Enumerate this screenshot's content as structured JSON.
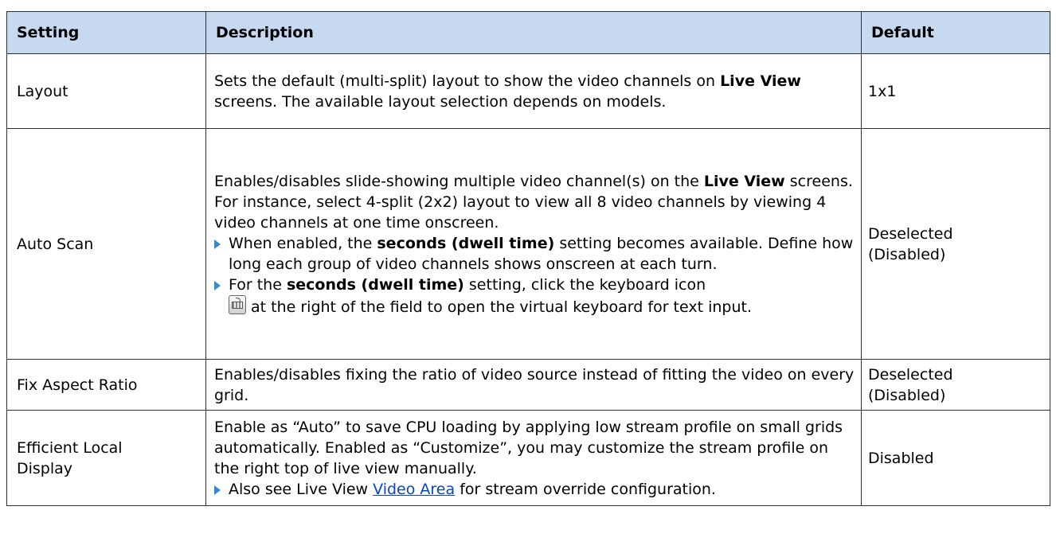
{
  "headers": {
    "setting": "Setting",
    "description": "Description",
    "default": "Default"
  },
  "rows": {
    "layout": {
      "setting": "Layout",
      "desc": {
        "t1": "Sets the default (multi-split) layout to show the video channels on",
        "b1": "Live View",
        "t2": "screens. The available layout selection depends on models."
      },
      "default": "1x1"
    },
    "auto_scan": {
      "setting": "Auto Scan",
      "desc": {
        "t1": "Enables/disables slide-showing multiple video channel(s) on the",
        "b1": "Live View",
        "t2": "screens. For instance, select 4-split (2x2) layout to view all 8 video channels by viewing 4 video channels at one time onscreen.",
        "bullet1_t1": "When enabled, the",
        "bullet1_b1": "seconds (dwell time)",
        "bullet1_t2": "setting becomes available. Define how long each group of video channels shows onscreen at each turn.",
        "bullet2_t1": "For the",
        "bullet2_b1": "seconds (dwell time)",
        "bullet2_t2": "setting, click the keyboard icon",
        "bullet2_t3": "at the right of the field to open the virtual keyboard for text input."
      },
      "default_l1": "Deselected",
      "default_l2": "(Disabled)"
    },
    "fix_aspect": {
      "setting": "Fix Aspect Ratio",
      "desc": "Enables/disables fixing the ratio of video source instead of fitting the video on every grid.",
      "default_l1": "Deselected",
      "default_l2": "(Disabled)"
    },
    "efficient": {
      "setting_l1": "Efficient Local",
      "setting_l2": "Display",
      "desc": {
        "t1": "Enable as “Auto” to save CPU loading by applying low stream profile on small grids automatically. Enabled as “Customize”, you may customize the stream profile on the right top of live view manually.",
        "bullet_t1": "Also see Live View",
        "bullet_link": "Video Area",
        "bullet_t2": "for stream override configuration."
      },
      "default": "Disabled"
    }
  },
  "icons": {
    "bullet": "triangle-bullet-icon",
    "keyboard": "keyboard-icon"
  },
  "colors": {
    "header_bg": "#c6d9f1",
    "bullet": "#2e8bd4",
    "link": "#0645c8"
  }
}
